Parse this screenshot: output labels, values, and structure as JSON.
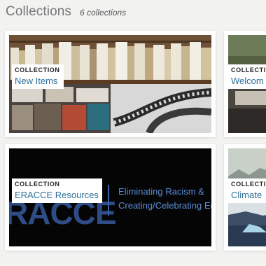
{
  "header": {
    "title": "Collections",
    "count": "6 collections"
  },
  "collections": [
    {
      "kicker": "COLLECTION",
      "name": "New Items",
      "art": "books-vinyl-film-photo"
    },
    {
      "kicker": "COLLECTION",
      "name": "Welcom",
      "art": "building-interior-photo"
    },
    {
      "kicker": "COLLECTION",
      "name": "ERACCE Resources",
      "art": "eracce-logo-banner",
      "art_text": {
        "wordmark": "RACCE",
        "tagline_line1": "Eliminating Racism &",
        "tagline_line2": "Creating/Celebrating Equ"
      }
    },
    {
      "kicker": "COLLECTION",
      "name": "Climate",
      "art": "glacier-landscape-photo"
    }
  ],
  "colors": {
    "background": "#f2f2f1",
    "link": "#2f6f9a",
    "eracce_blue": "#2e4c86"
  }
}
